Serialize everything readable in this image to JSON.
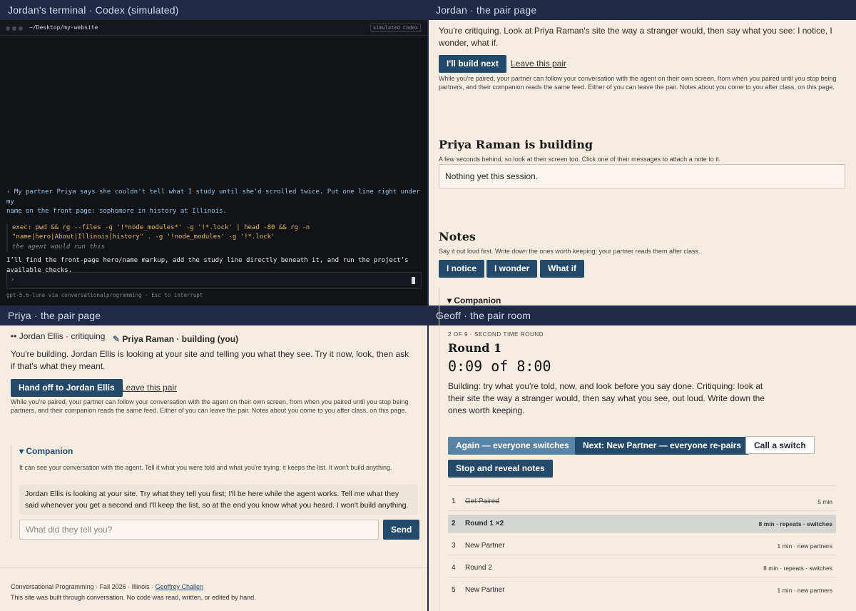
{
  "panes": {
    "terminal": "Jordan's terminal · Codex (simulated)",
    "jordan": "Jordan · the pair page",
    "priya": "Priya · the pair page",
    "geoff": "Geoff · the pair room"
  },
  "terminal": {
    "path": "~/Desktop/my-website",
    "badge": "simulated Codex",
    "user_line1": "› My partner Priya says she couldn't tell what I study until she'd scrolled twice. Put one line right under my",
    "user_line2": "name on the front page: sophomore in history at Illinois.",
    "exec_line1": "exec: pwd && rg --files -g '!*node_modules*' -g '!*.lock' | head -80 && rg -n",
    "exec_line2": "\"name|hero|About|Illinois|history\" . -g '!node_modules' -g '!*.lock'",
    "exec_note": "the agent would run this",
    "agent_line1": "I’ll find the front-page hero/name markup, add the study line directly beneath it, and run the project’s",
    "agent_line2": "available checks.",
    "prompt": "›",
    "footer": "gpt-5.6-luna via conversationalprogramming  ·  Esc to interrupt"
  },
  "jordan": {
    "intro": "You're critiquing. Look at Priya Raman's site the way a stranger would, then say what you see: I notice, I wonder, what if.",
    "build_next": "I'll build next",
    "leave": "Leave this pair",
    "pair_note": "While you're paired, your partner can follow your conversation with the agent on their own screen, from when you paired until you stop being partners, and their companion reads the same feed. Either of you can leave the pair. Notes about you come to you after class, on this page.",
    "building_heading": "Priya Raman is building",
    "building_sub": "A few seconds behind, so look at their screen too. Click one of their messages to attach a note to it.",
    "nothing_yet": "Nothing yet this session.",
    "notes_heading": "Notes",
    "notes_sub": "Say it out loud first. Write down the ones worth keeping; your partner reads them after class.",
    "notice": "I notice",
    "wonder": "I wonder",
    "whatif": "What if",
    "companion": "▾ Companion"
  },
  "priya": {
    "member1": "Jordan Ellis · critiquing",
    "member2": "Priya Raman · building (you)",
    "intro": "You're building. Jordan Ellis is looking at your site and telling you what they see. Try it now, look, then ask if that's what they meant.",
    "handoff": "Hand off to Jordan Ellis",
    "leave": "Leave this pair",
    "pair_note": "While you're paired, your partner can follow your conversation with the agent on their own screen, from when you paired until you stop being partners, and their companion reads the same feed. Either of you can leave the pair. Notes about you come to you after class, on this page.",
    "companion": "▾ Companion",
    "companion_sub": "It can see your conversation with the agent. Tell it what you were told and what you're trying; it keeps the list. It won't build anything.",
    "companion_msg": "Jordan Ellis is looking at your site. Try what they tell you first; I'll be here while the agent works. Tell me what they said whenever you get a second and I'll keep the list, so at the end you know what you heard. I won't build anything.",
    "input_placeholder": "What did they tell you?",
    "send": "Send",
    "footer_course": "Conversational Programming",
    "footer_term": "Fall 2026",
    "footer_place": "Illinois",
    "footer_author": "Geoffrey Challen",
    "footer_note": "This site was built through conversation. No code was read, written, or edited by hand."
  },
  "geoff": {
    "kicker": "2 OF 9 · SECOND TIME ROUND",
    "round_title": "Round 1",
    "timer": "0:09 of 8:00",
    "instructions": "Building: try what you're told, now, and look before you say done. Critiquing: look at their site the way a stranger would, then say what you see, out loud. Write down the ones worth keeping.",
    "again": "Again — everyone switches",
    "next": "Next: New Partner — everyone re-pairs",
    "call_switch": "Call a switch",
    "stop": "Stop and reveal notes",
    "rounds": [
      {
        "n": "1",
        "name": "Get Paired",
        "meta": "5 min"
      },
      {
        "n": "2",
        "name": "Round 1 ×2",
        "meta": "8 min · repeats · switches"
      },
      {
        "n": "3",
        "name": "New Partner",
        "meta": "1 min · new partners"
      },
      {
        "n": "4",
        "name": "Round 2",
        "meta": "8 min · repeats · switches"
      },
      {
        "n": "5",
        "name": "New Partner",
        "meta": "1 min · new partners"
      }
    ]
  },
  "colors": {
    "navy": "#23496b",
    "header": "#1f2b45",
    "cream": "#f4ede0",
    "terminal": "#121317"
  }
}
